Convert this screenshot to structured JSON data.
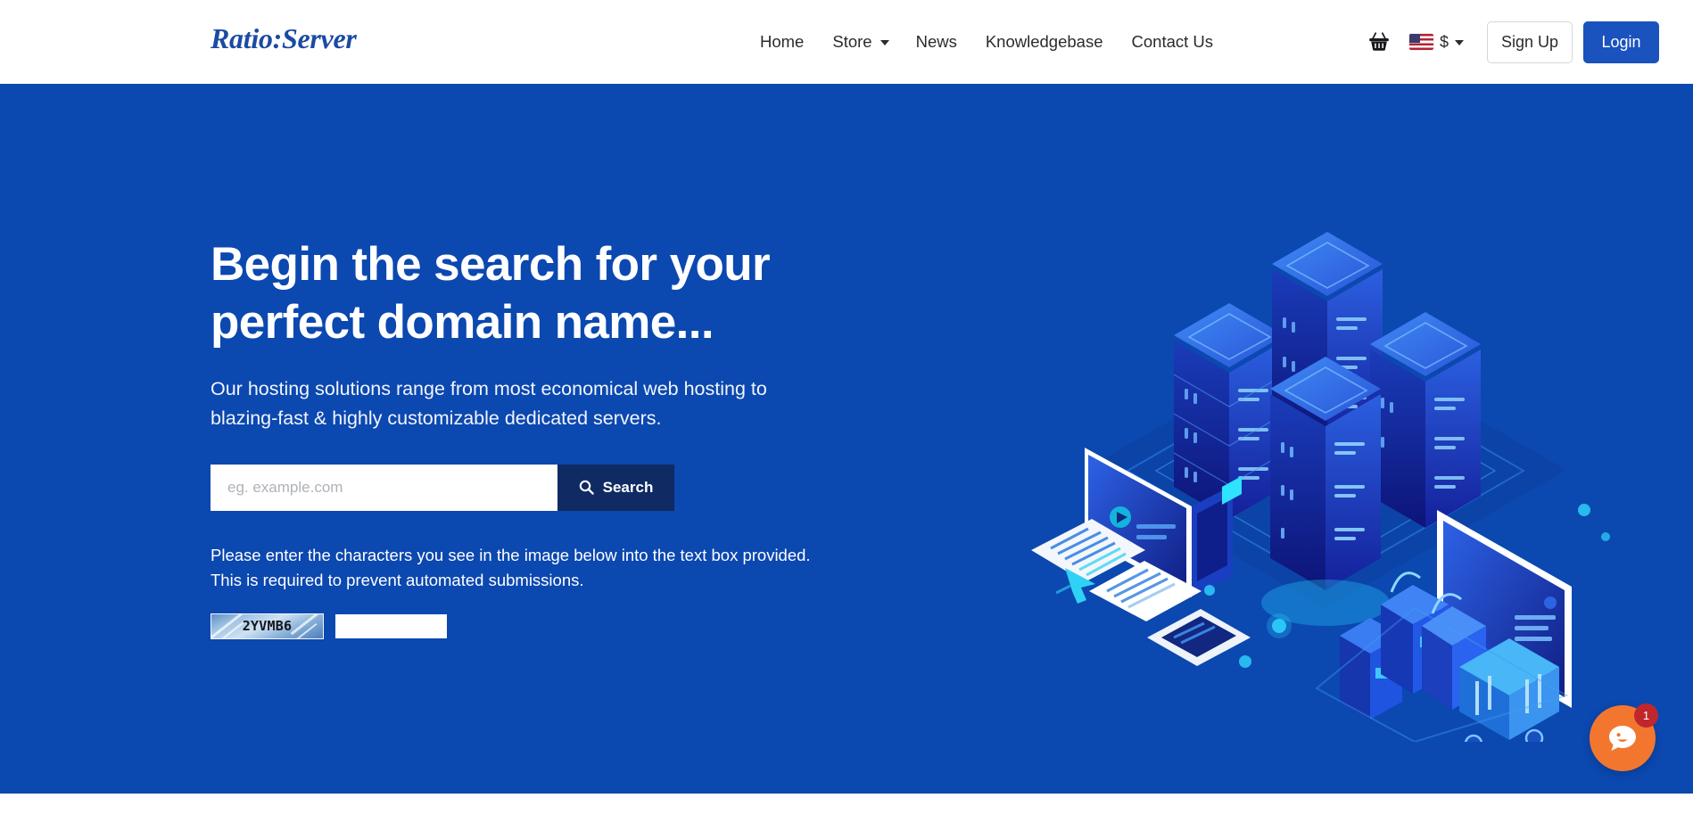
{
  "header": {
    "logo": "Ratio:Server",
    "nav": [
      {
        "label": "Home",
        "caret": false
      },
      {
        "label": "Store",
        "caret": true
      },
      {
        "label": "News",
        "caret": false
      },
      {
        "label": "Knowledgebase",
        "caret": false
      },
      {
        "label": "Contact Us",
        "caret": false
      }
    ],
    "basket_icon": "shopping-basket-icon",
    "flag_icon": "us-flag-icon",
    "currency": "$",
    "currency_caret_icon": "chevron-down-icon",
    "signup_label": "Sign Up",
    "login_label": "Login"
  },
  "hero": {
    "title": "Begin the search for your perfect domain name...",
    "subtitle": "Our hosting solutions range from most economical web hosting to blazing-fast & highly customizable dedicated servers.",
    "search": {
      "placeholder": "eg. example.com",
      "value": "",
      "button_label": "Search",
      "button_icon": "search-icon"
    },
    "captcha": {
      "note": "Please enter the characters you see in the image below into the text box provided. This is required to prevent automated submissions.",
      "code": "2YVMB6",
      "input_value": ""
    },
    "illustration": "isometric-datacenter-ecommerce-illustration"
  },
  "chat": {
    "icon": "chat-bubble-icon",
    "badge_count": "1"
  },
  "colors": {
    "hero_bg": "#0b48b0",
    "login_btn": "#1a52be",
    "search_btn": "#102a63",
    "logo_blue": "#1b4ba3",
    "chat_orange": "#f3762f",
    "chat_badge_red": "#c0272d"
  }
}
